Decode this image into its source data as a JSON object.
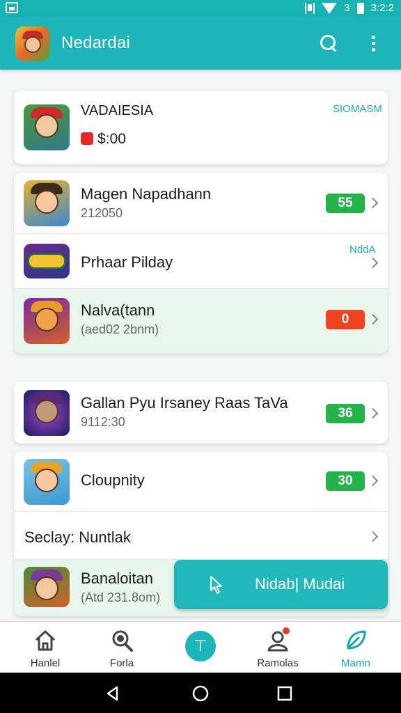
{
  "status_bar": {
    "time": "3:2:2",
    "battery_text": "3"
  },
  "app_bar": {
    "title": "Nedardai"
  },
  "featured": {
    "title": "VADAIESIA",
    "price": "$:00",
    "tag": "SIOMASM"
  },
  "list_a": [
    {
      "name": "Magen Napadhann",
      "sub": "212050",
      "badge": "55",
      "badge_color": "green"
    },
    {
      "name": "Prhaar Pilday",
      "sub": "",
      "tag": "NddA"
    },
    {
      "name": "Nalva(tann",
      "sub": "(aed02 2bnm)",
      "badge": "0",
      "badge_color": "red"
    }
  ],
  "list_b": [
    {
      "name": "Gallan Pyu Irsaney Raas TaVa",
      "sub": "9112:30",
      "badge": "36",
      "badge_color": "green"
    }
  ],
  "list_c": [
    {
      "name": "Cloupnity",
      "sub": "",
      "badge": "30",
      "badge_color": "green"
    },
    {
      "name": "Seclay: Nuntlak",
      "sub": ""
    },
    {
      "name": "Banaloitan",
      "sub": "(Atd 231.8om)"
    }
  ],
  "action_button": {
    "label": "Nidab| Mudai"
  },
  "bottom_nav": [
    {
      "label": "Hanlel",
      "icon": "home-icon"
    },
    {
      "label": "Forla",
      "icon": "magnifier-icon"
    },
    {
      "label": "",
      "icon": "center-action-icon"
    },
    {
      "label": "Ramolas",
      "icon": "profile-icon"
    },
    {
      "label": "Mamn",
      "icon": "leaf-icon"
    }
  ],
  "colors": {
    "accent": "#1db5b9",
    "green_badge": "#24b34a",
    "red_badge": "#ee4420"
  }
}
